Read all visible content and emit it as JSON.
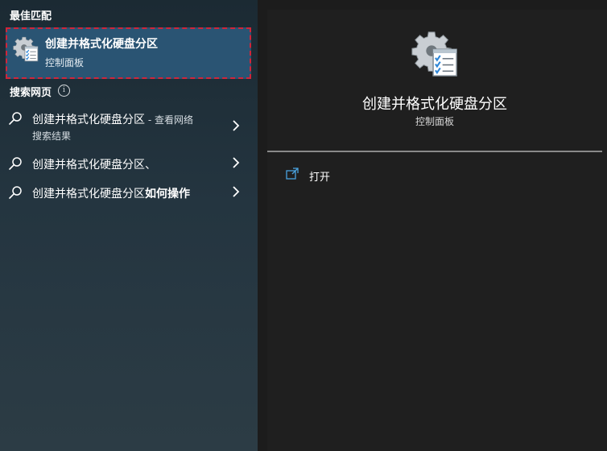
{
  "left": {
    "best_match_title": "最佳匹配",
    "best_match": {
      "title": "创建并格式化硬盘分区",
      "subtitle": "控制面板",
      "icon": "control-panel-tasks-icon"
    },
    "web_search_title": "搜索网页",
    "web_results": [
      {
        "query": "创建并格式化硬盘分区",
        "extra": " - 查看网络",
        "line2": "搜索结果",
        "icon": "search-icon"
      },
      {
        "query": "创建并格式化硬盘分区、",
        "icon": "search-icon"
      },
      {
        "query_normal": "创建并格式化硬盘分区",
        "query_bold": "如何操作",
        "icon": "search-icon"
      }
    ]
  },
  "right": {
    "title": "创建并格式化硬盘分区",
    "subtitle": "控制面板",
    "actions": [
      {
        "label": "打开",
        "icon": "open-icon"
      }
    ]
  },
  "colors": {
    "highlight": "#2a5473",
    "focus_border": "#d0253a",
    "accent": "#4aa3e0"
  }
}
